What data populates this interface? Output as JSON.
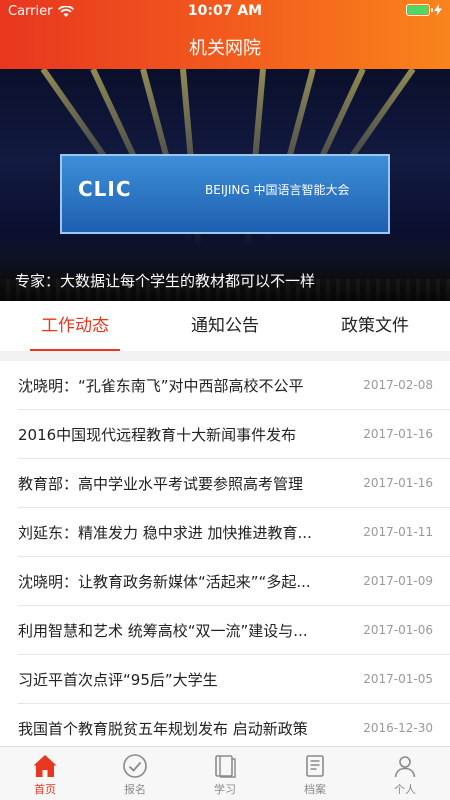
{
  "status_bar": {
    "carrier": "Carrier",
    "time": "10:07 AM"
  },
  "nav": {
    "title": "机关网院"
  },
  "banner": {
    "caption": "专家：大数据让每个学生的教材都可以不一样",
    "screen_text": "CLIC",
    "screen_sub": "BEIJING  中国语言智能大会"
  },
  "tabs": [
    {
      "label": "工作动态",
      "active": true
    },
    {
      "label": "通知公告",
      "active": false
    },
    {
      "label": "政策文件",
      "active": false
    }
  ],
  "news": [
    {
      "title": "沈晓明：“孔雀东南飞”对中西部高校不公平",
      "date": "2017-02-08"
    },
    {
      "title": "2016中国现代远程教育十大新闻事件发布",
      "date": "2017-01-16"
    },
    {
      "title": "教育部：高中学业水平考试要参照高考管理",
      "date": "2017-01-16"
    },
    {
      "title": "刘延东：精准发力 稳中求进 加快推进教育...",
      "date": "2017-01-11"
    },
    {
      "title": "沈晓明：让教育政务新媒体“活起来”“多起...",
      "date": "2017-01-09"
    },
    {
      "title": "利用智慧和艺术 统筹高校“双一流”建设与...",
      "date": "2017-01-06"
    },
    {
      "title": "习近平首次点评“95后”大学生",
      "date": "2017-01-05"
    },
    {
      "title": "我国首个教育脱贫五年规划发布 启动新政策",
      "date": "2016-12-30"
    }
  ],
  "tabbar": [
    {
      "label": "首页",
      "icon": "home-icon",
      "active": true
    },
    {
      "label": "报名",
      "icon": "check-circle-icon",
      "active": false
    },
    {
      "label": "学习",
      "icon": "book-icon",
      "active": false
    },
    {
      "label": "档案",
      "icon": "archive-icon",
      "active": false
    },
    {
      "label": "个人",
      "icon": "person-icon",
      "active": false
    }
  ],
  "colors": {
    "accent": "#e8361f",
    "gradient_end": "#f9841c",
    "muted": "#8a8a8a"
  }
}
